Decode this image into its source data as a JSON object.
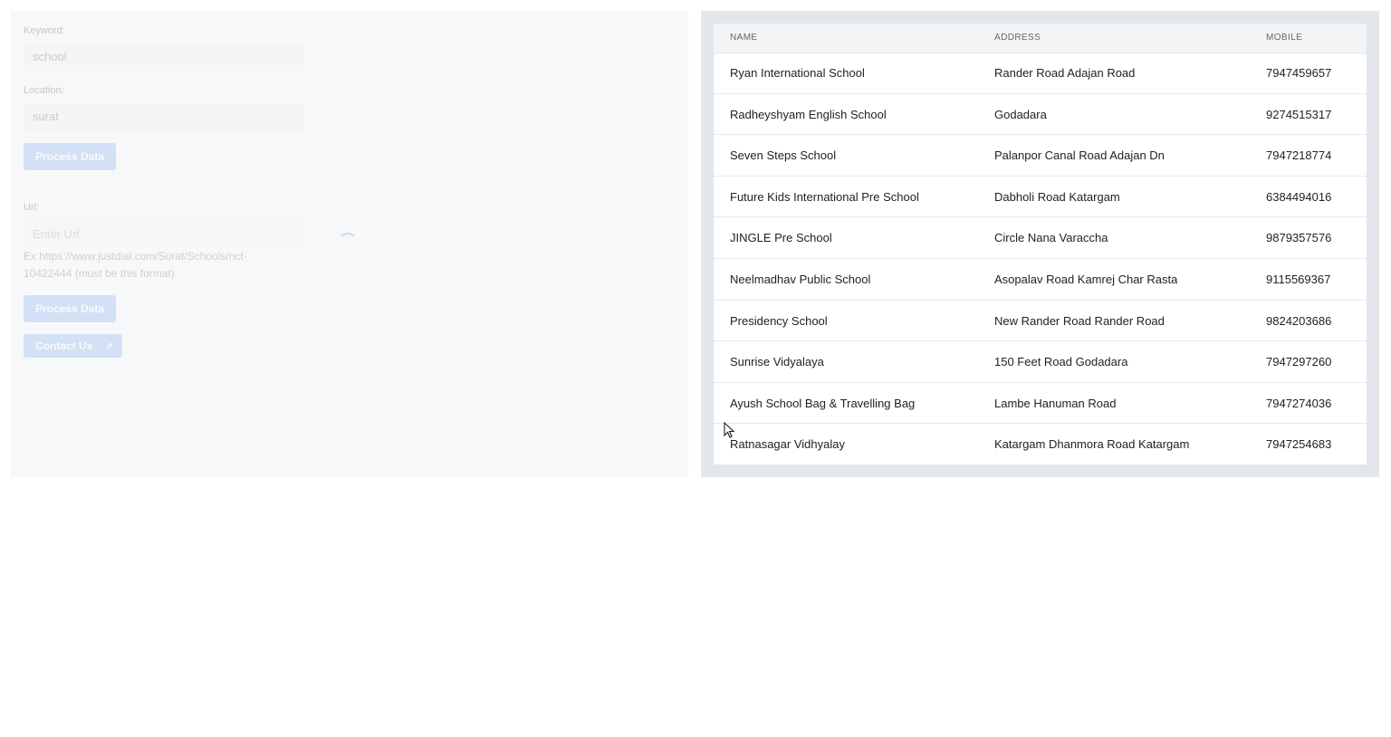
{
  "form": {
    "keyword_label": "Keyword:",
    "keyword_value": "school",
    "location_label": "Location:",
    "location_value": "surat",
    "process_label_1": "Process Data",
    "url_label": "Url:",
    "url_placeholder": "Enter Url",
    "url_help": "Ex https://www.justdial.com/Surat/Schools/nct-10422444 (must be this format)",
    "process_label_2": "Process Data",
    "contact_label": "Contact Us"
  },
  "table": {
    "headers": [
      "NAME",
      "ADDRESS",
      "MOBILE"
    ],
    "rows": [
      {
        "name": "Ryan International School",
        "address": "Rander Road Adajan Road",
        "mobile": "7947459657"
      },
      {
        "name": "Radheyshyam English School",
        "address": "Godadara",
        "mobile": "9274515317"
      },
      {
        "name": "Seven Steps School",
        "address": "Palanpor Canal Road Adajan Dn",
        "mobile": "7947218774"
      },
      {
        "name": "Future Kids International Pre School",
        "address": "Dabholi Road Katargam",
        "mobile": "6384494016"
      },
      {
        "name": "JINGLE Pre School",
        "address": "Circle Nana Varaccha",
        "mobile": "9879357576"
      },
      {
        "name": "Neelmadhav Public School",
        "address": "Asopalav Road Kamrej Char Rasta",
        "mobile": "9115569367"
      },
      {
        "name": "Presidency School",
        "address": "New Rander Road Rander Road",
        "mobile": "9824203686"
      },
      {
        "name": "Sunrise Vidyalaya",
        "address": "150 Feet Road Godadara",
        "mobile": "7947297260"
      },
      {
        "name": "Ayush School Bag & Travelling Bag",
        "address": "Lambe Hanuman Road",
        "mobile": "7947274036"
      },
      {
        "name": "Ratnasagar Vidhyalay",
        "address": "Katargam Dhanmora Road Katargam",
        "mobile": "7947254683"
      }
    ]
  },
  "icons": {
    "contact": "external-link-icon",
    "loading": "spinner-icon",
    "cursor": "mouse-pointer-icon"
  },
  "colors": {
    "button": "#7aa7ef",
    "table_bg": "#ffffff",
    "panel_bg": "#e3e6ea"
  }
}
